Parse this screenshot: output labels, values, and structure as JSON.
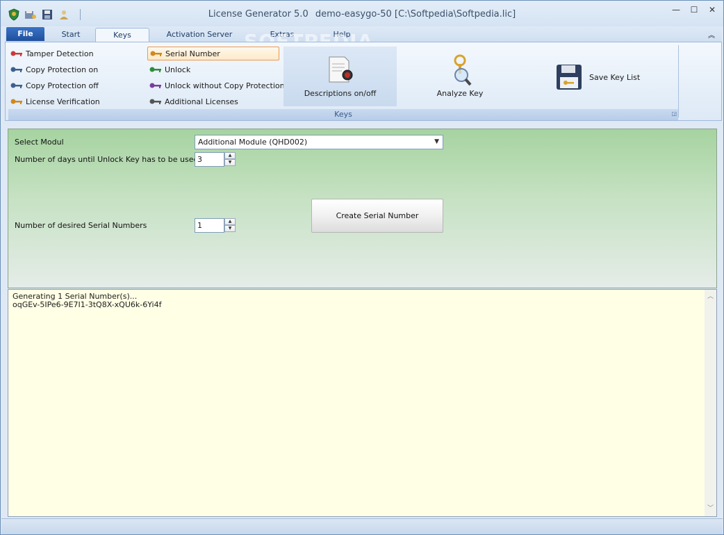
{
  "window": {
    "app_name": "License Generator 5.0",
    "document": "demo-easygo-50 [C:\\Softpedia\\Softpedia.lic]"
  },
  "tabs": [
    {
      "label": "File"
    },
    {
      "label": "Start"
    },
    {
      "label": "Keys"
    },
    {
      "label": "Activation Server"
    },
    {
      "label": "Extras"
    },
    {
      "label": "Help"
    }
  ],
  "ribbon": {
    "group_label": "Keys",
    "items_col1": [
      {
        "label": "Tamper Detection",
        "color": "#c83b3b"
      },
      {
        "label": "Copy Protection on",
        "color": "#3d5f8c"
      },
      {
        "label": "Copy Protection off",
        "color": "#3d5f8c"
      },
      {
        "label": "License Verification",
        "color": "#d08a1e"
      }
    ],
    "items_col2": [
      {
        "label": "Serial Number",
        "color": "#d08a1e"
      },
      {
        "label": "Unlock",
        "color": "#2f8c3a"
      },
      {
        "label": "Unlock without Copy Protection",
        "color": "#7a3d9c"
      },
      {
        "label": "Additional Licenses",
        "color": "#555555"
      }
    ],
    "descriptions_label": "Descriptions on/off",
    "analyze_label": "Analyze Key",
    "save_label": "Save Key List"
  },
  "form": {
    "select_modul_label": "Select Modul",
    "select_modul_value": "Additional Module (QHD002)",
    "days_label": "Number of days until Unlock Key has to be used",
    "days_value": "3",
    "serials_label": "Number of desired Serial Numbers",
    "serials_value": "1",
    "create_label": "Create Serial Number"
  },
  "output": {
    "lines": [
      "Generating 1 Serial Number(s)...",
      "oqGEv-5IPe6-9E7I1-3tQ8X-xQU6k-6Yi4f"
    ]
  },
  "watermark": "SOFTPEDIA"
}
